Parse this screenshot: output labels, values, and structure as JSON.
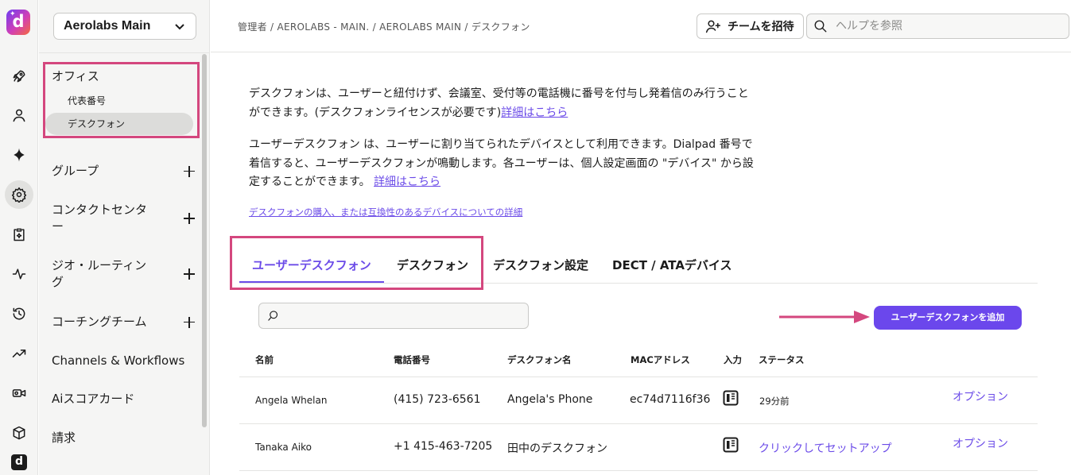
{
  "rail": {
    "logo_letter": "d",
    "icons": [
      "rocket-icon",
      "person-icon",
      "sparkle-icon",
      "settings-gear-icon",
      "clipboard-sparkle-icon",
      "activity-icon",
      "history-icon",
      "trending-icon",
      "video-icon",
      "cube-icon",
      "dialpad-mini-icon"
    ]
  },
  "sidebar": {
    "org": "Aerolabs Main",
    "office": "オフィス",
    "main_number": "代表番号",
    "deskphone": "デスクフォン",
    "items": [
      {
        "label": "グループ"
      },
      {
        "label": "コンタクトセンター"
      },
      {
        "label": "ジオ・ルーティング"
      },
      {
        "label": "コーチングチーム"
      },
      {
        "label": "Channels & Workflows"
      },
      {
        "label": "Aiスコアカード"
      },
      {
        "label": "請求"
      }
    ]
  },
  "header": {
    "breadcrumb": "管理者 / AEROLABS - MAIN. / AEROLABS MAIN / デスクフォン",
    "invite_label": "チームを招待",
    "help_placeholder": "ヘルプを参照"
  },
  "main": {
    "para1": "デスクフォンは、ユーザーと紐付けず、会議室、受付等の電話機に番号を付与し発着信のみ行うことができます。(デスクフォンライセンスが必要です)",
    "para1_link": "詳細はこちら",
    "para2": "ユーザーデスクフォン は、ユーザーに割り当てられたデバイスとして利用できます。Dialpad 番号で着信すると、ユーザーデスクフォンが鳴動します。各ユーザーは、個人設定画面の \"デバイス\" から設定することができます。",
    "para2_link": "詳細はこちら",
    "purchase_link": "デスクフォンの購入、または互換性のあるデバイスについての詳細",
    "tabs": [
      "ユーザーデスクフォン",
      "デスクフォン",
      "デスクフォン設定",
      "DECT / ATAデバイス"
    ],
    "add_button": "ユーザーデスクフォンを追加",
    "search_value": ""
  },
  "table": {
    "headers": [
      "名前",
      "電話番号",
      "デスクフォン名",
      "MACアドレス",
      "入力",
      "ステータス"
    ],
    "rows": [
      {
        "name": "Angela Whelan",
        "phone": "(415) 723-6561",
        "device": "Angela's Phone",
        "mac": "ec74d7116f36",
        "status": "29分前",
        "option": "オプション"
      },
      {
        "name": "Tanaka Aiko",
        "phone": "+1 415-463-7205",
        "device": "田中のデスクフォン",
        "mac": "",
        "status": "クリックしてセットアップ",
        "option": "オプション"
      }
    ]
  },
  "colors": {
    "accent": "#6b47ec",
    "highlight": "#d4477e",
    "link": "#6b4be8"
  }
}
